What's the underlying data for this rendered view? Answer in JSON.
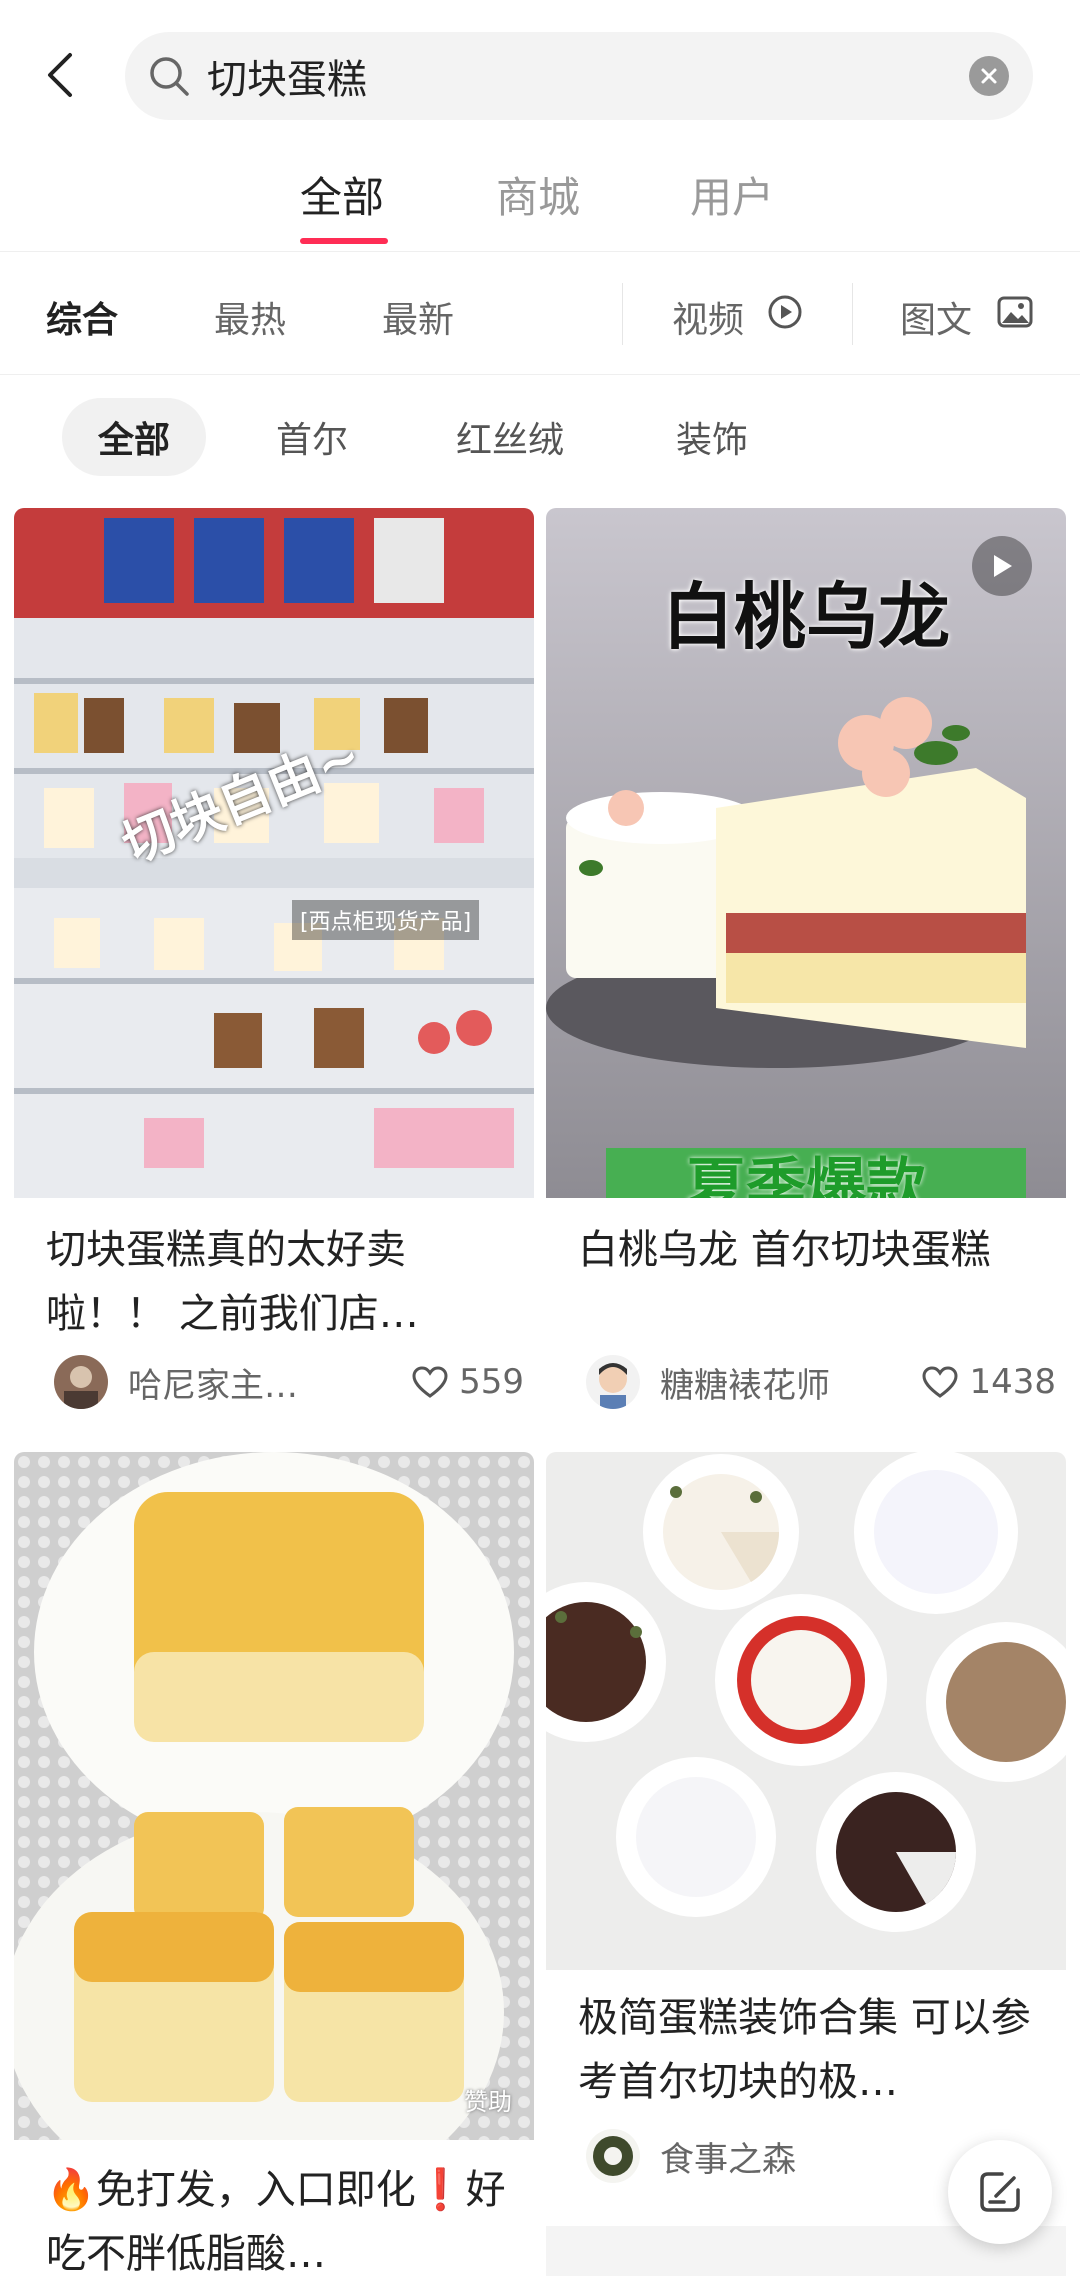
{
  "search": {
    "query": "切块蛋糕"
  },
  "main_tabs": [
    {
      "label": "全部",
      "active": true
    },
    {
      "label": "商城",
      "active": false
    },
    {
      "label": "用户",
      "active": false
    }
  ],
  "sort_bar": {
    "items": [
      "综合",
      "最热",
      "最新"
    ],
    "active": "综合",
    "video_label": "视频",
    "image_text_label": "图文"
  },
  "chips": [
    "全部",
    "首尔",
    "红丝绒",
    "装饰"
  ],
  "cards": [
    {
      "title": "切块蛋糕真的太好卖啦！！ 之前我们店…",
      "author": "哈尼家主…",
      "likes": "559",
      "overlay_text": "切块自由~",
      "overlay_tag": "[西点柜现货产品]"
    },
    {
      "title": "白桃乌龙 首尔切块蛋糕",
      "author": "糖糖裱花师",
      "likes": "1438",
      "overlay_title": "白桃乌龙",
      "overlay_bottom": "夏季爆款"
    },
    {
      "title": "🔥免打发，入口即化❗好吃不胖低脂酸…",
      "overlay_tag": "赞助"
    },
    {
      "title": "极简蛋糕装饰合集 可以参考首尔切块的极…",
      "author": "食事之森"
    }
  ],
  "colors": {
    "accent": "#ff2d55",
    "text": "#222222",
    "muted": "#999999"
  }
}
